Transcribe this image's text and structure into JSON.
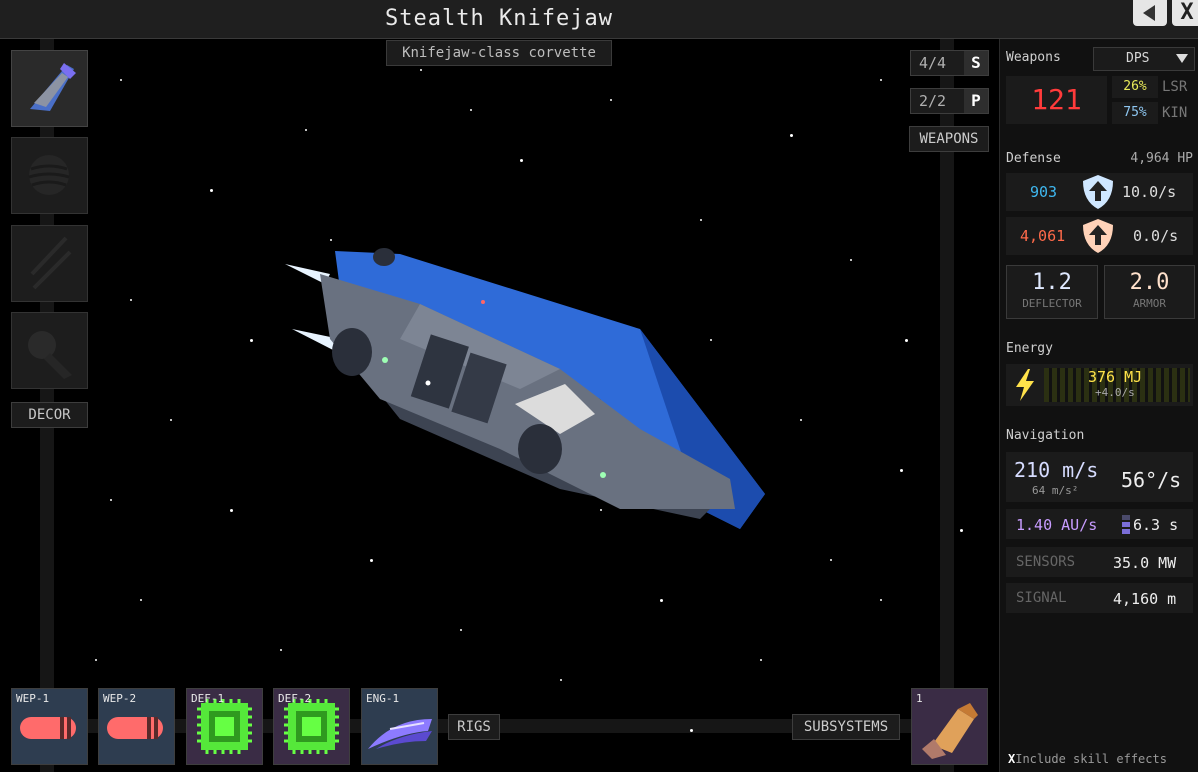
{
  "title": "Stealth Knifejaw",
  "subtitle": "Knifejaw-class corvette",
  "window": {
    "back_icon": "back-arrow-icon",
    "close_label": "X"
  },
  "left_slots": [
    {
      "name": "ship-hull-slot",
      "icon": "ship-icon"
    },
    {
      "name": "paint-slot",
      "icon": "sphere-icon"
    },
    {
      "name": "stripe-slot",
      "icon": "stripes-icon"
    },
    {
      "name": "trail-slot",
      "icon": "comet-icon"
    }
  ],
  "decor_label": "DECOR",
  "counters": {
    "s": {
      "value": "4/4",
      "letter": "S"
    },
    "p": {
      "value": "2/2",
      "letter": "P"
    }
  },
  "weapons_button": "WEAPONS",
  "bottom_slots": [
    {
      "label": "WEP-1",
      "icon": "kinetic-shell-icon"
    },
    {
      "label": "WEP-2",
      "icon": "kinetic-shell-icon"
    },
    {
      "label": "DEF-1",
      "icon": "chip-icon"
    },
    {
      "label": "DEF-2",
      "icon": "chip-icon"
    },
    {
      "label": "ENG-1",
      "icon": "engine-wing-icon"
    }
  ],
  "rigs_label": "RIGS",
  "subsystems_label": "SUBSYSTEMS",
  "subsystem_slot": {
    "label": "1",
    "icon": "thruster-icon"
  },
  "stats": {
    "weapons": {
      "title": "Weapons",
      "mode": "DPS",
      "dps": "121",
      "lsr_pct": "26%",
      "lsr_label": "LSR",
      "kin_pct": "75%",
      "kin_label": "KIN"
    },
    "defense": {
      "title": "Defense",
      "hp": "4,964 HP",
      "shield_value": "903",
      "shield_regen": "10.0/s",
      "armor_value": "4,061",
      "armor_regen": "0.0/s",
      "deflector_value": "1.2",
      "deflector_label": "DEFLECTOR",
      "armor_rating": "2.0",
      "armor_label": "ARMOR"
    },
    "energy": {
      "title": "Energy",
      "value": "376 MJ",
      "rate": "+4.0/s"
    },
    "navigation": {
      "title": "Navigation",
      "speed": "210 m/s",
      "accel": "64 m/s²",
      "turn": "56°/s",
      "warp_speed": "1.40 AU/s",
      "warp_time": "6.3 s",
      "sensors_label": "SENSORS",
      "sensors_value": "35.0 MW",
      "signal_label": "SIGNAL",
      "signal_value": "4,160 m"
    }
  },
  "include_skill_effects": {
    "mark": "X",
    "label": "Include skill effects"
  },
  "colors": {
    "shield": "#3fb8f0",
    "armor": "#ff6a4a",
    "dps": "#ff3b3b",
    "energy": "#ffe24a",
    "hull_blue": "#2f6bd8",
    "chip_green": "#66ff44"
  }
}
